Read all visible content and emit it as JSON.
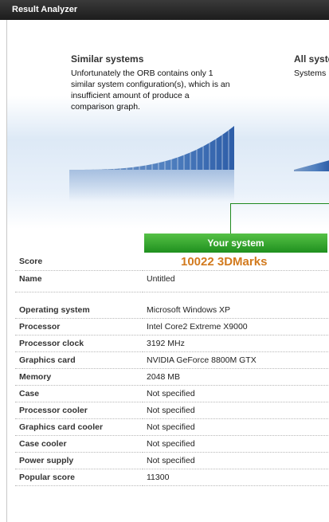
{
  "window": {
    "title": "Result Analyzer"
  },
  "similar": {
    "title": "Similar systems",
    "message": "Unfortunately the ORB contains only 1 similar system configuration(s), which is an insufficient amount of produce a comparison graph."
  },
  "all_systems": {
    "title": "All syste",
    "text": "Systems"
  },
  "your_system_label": "Your system",
  "score": {
    "label": "Score",
    "value": "10022 3DMarks"
  },
  "name_row": {
    "label": "Name",
    "value": "Untitled"
  },
  "specs": [
    {
      "label": "Operating system",
      "value": "Microsoft Windows XP"
    },
    {
      "label": "Processor",
      "value": "Intel Core2 Extreme X9000"
    },
    {
      "label": "Processor clock",
      "value": "3192 MHz"
    },
    {
      "label": "Graphics card",
      "value": "NVIDIA GeForce 8800M GTX"
    },
    {
      "label": "Memory",
      "value": "2048 MB"
    },
    {
      "label": "Case",
      "value": "Not specified"
    },
    {
      "label": "Processor cooler",
      "value": "Not specified"
    },
    {
      "label": "Graphics card cooler",
      "value": "Not specified"
    },
    {
      "label": "Case cooler",
      "value": "Not specified"
    },
    {
      "label": "Power supply",
      "value": "Not specified"
    },
    {
      "label": "Popular score",
      "value": "11300"
    }
  ],
  "colors": {
    "score": "#d27a1e",
    "your_system": "#2e9e2e",
    "graph": "#3c6ea8"
  }
}
